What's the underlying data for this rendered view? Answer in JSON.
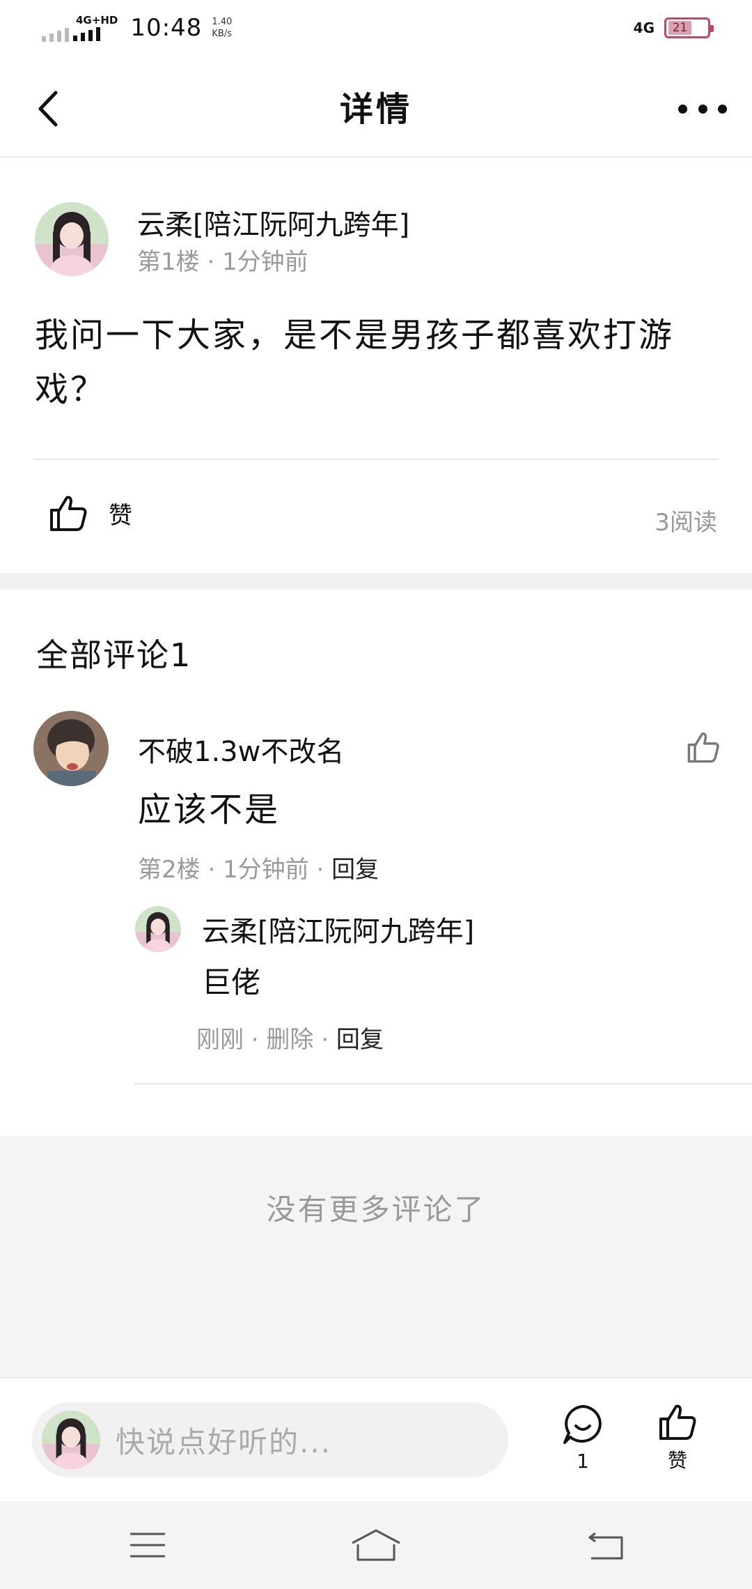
{
  "status_bar": {
    "network_label": "4G+HD",
    "time": "10:48",
    "speed_value": "1.40",
    "speed_unit": "KB/s",
    "right_network": "4G",
    "battery": "21"
  },
  "header": {
    "title": "详情"
  },
  "post": {
    "author": "云柔[陪江阮阿九跨年]",
    "meta": "第1楼 · 1分钟前",
    "content": "我问一下大家，是不是男孩子都喜欢打游戏？",
    "like_label": "赞",
    "read_count": "3阅读"
  },
  "comments": {
    "title": "全部评论1",
    "items": [
      {
        "author": "不破1.3w不改名",
        "text": "应该不是",
        "meta": "第2楼 · 1分钟前 · ",
        "reply_label": "回复",
        "replies": [
          {
            "author": "云柔[陪江阮阿九跨年]",
            "text": "巨佬",
            "meta": "刚刚 · 删除 · ",
            "reply_label": "回复"
          }
        ]
      }
    ],
    "no_more": "没有更多评论了"
  },
  "bottom_bar": {
    "placeholder": "快说点好听的...",
    "comment_count": "1",
    "like_label": "赞"
  },
  "icons": {
    "back": "chevron-left-icon",
    "more": "more-dots-icon",
    "like": "thumbs-up-icon",
    "comment": "comment-bubble-icon",
    "menu": "menu-icon",
    "home": "home-icon",
    "return": "return-icon"
  },
  "colors": {
    "accent_battery": "#c2486a",
    "muted_text": "#9a9a9a",
    "section_gray": "#f1f1f1"
  }
}
